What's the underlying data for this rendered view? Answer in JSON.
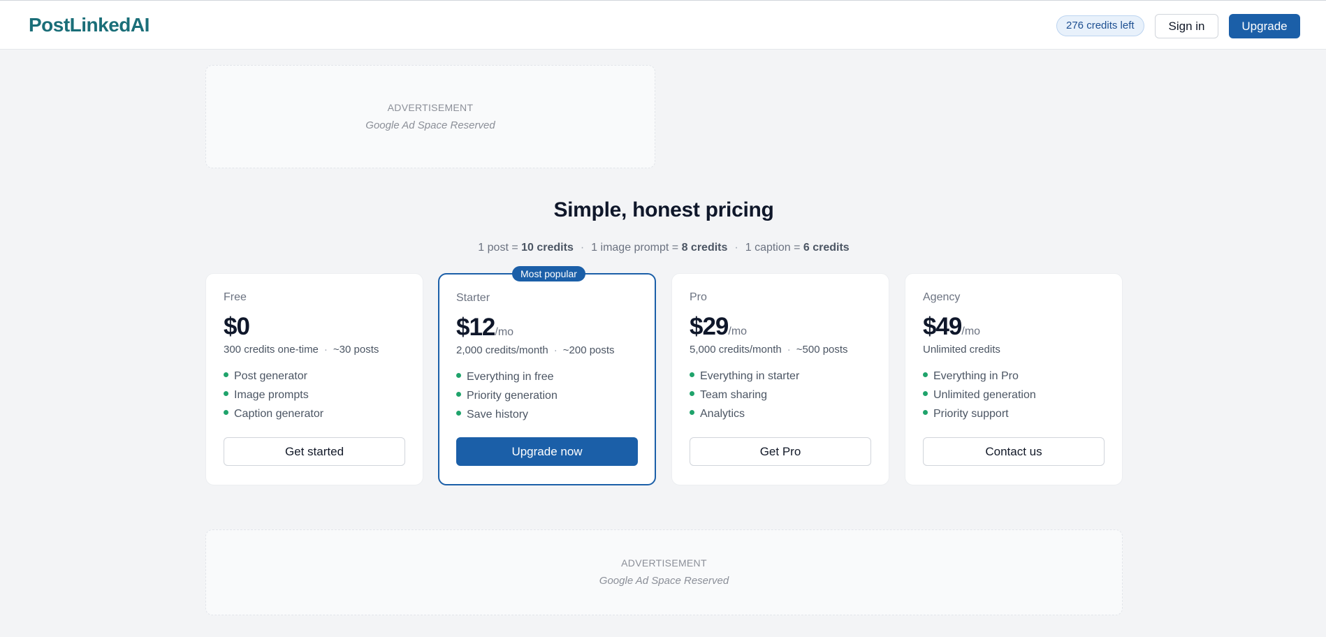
{
  "header": {
    "logo": "PostLinkedAI",
    "credits": "276 credits left",
    "signin_label": "Sign in",
    "upgrade_label": "Upgrade"
  },
  "ads": {
    "label": "ADVERTISEMENT",
    "text": "Google Ad Space Reserved"
  },
  "pricing": {
    "title": "Simple, honest pricing",
    "rates": [
      {
        "prefix": "1 post = ",
        "value": "10 credits"
      },
      {
        "prefix": "1 image prompt = ",
        "value": "8 credits"
      },
      {
        "prefix": "1 caption = ",
        "value": "6 credits"
      }
    ],
    "separator": "·",
    "plans": [
      {
        "name": "Free",
        "price": "$0",
        "per": "",
        "credits": "300 credits one-time",
        "posts": "~30 posts",
        "features": [
          "Post generator",
          "Image prompts",
          "Caption generator"
        ],
        "cta": "Get started"
      },
      {
        "name": "Starter",
        "price": "$12",
        "per": "/mo",
        "credits": "2,000 credits/month",
        "posts": "~200 posts",
        "features": [
          "Everything in free",
          "Priority generation",
          "Save history"
        ],
        "cta": "Upgrade now",
        "badge": "Most popular"
      },
      {
        "name": "Pro",
        "price": "$29",
        "per": "/mo",
        "credits": "5,000 credits/month",
        "posts": "~500 posts",
        "features": [
          "Everything in starter",
          "Team sharing",
          "Analytics"
        ],
        "cta": "Get Pro"
      },
      {
        "name": "Agency",
        "price": "$49",
        "per": "/mo",
        "credits": "Unlimited credits",
        "posts": "",
        "features": [
          "Everything in Pro",
          "Unlimited generation",
          "Priority support"
        ],
        "cta": "Contact us"
      }
    ]
  },
  "colors": {
    "brand": "#1b5fa8",
    "logo": "#1a6e78",
    "bullet": "#1fa36b",
    "background": "#f3f4f6"
  }
}
